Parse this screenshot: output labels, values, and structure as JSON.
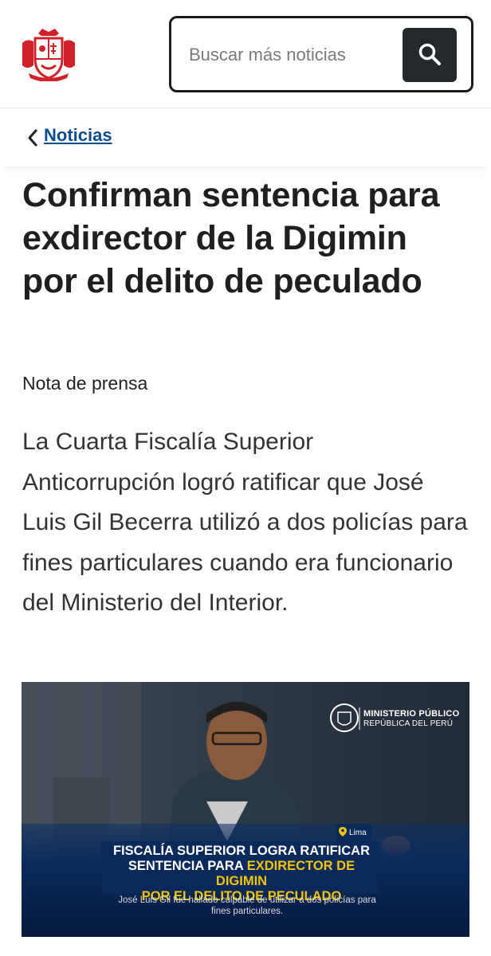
{
  "header": {
    "logo_icon": "peru-coat-of-arms-icon",
    "search": {
      "placeholder": "Buscar más noticias",
      "button_icon": "search-icon"
    }
  },
  "breadcrumb": {
    "back_icon": "chevron-left-icon",
    "label": "Noticias"
  },
  "article": {
    "title": "Confirman sentencia para exdirector de la Digimin por el delito de peculado",
    "type": "Nota de prensa",
    "lead": "La Cuarta Fiscalía Superior Anticorrupción logró ratificar que José Luis Gil Becerra utilizó a dos policías para fines particulares cuando era funcionario del Ministerio del Interior."
  },
  "image": {
    "logo_title": "MINISTERIO PÚBLICO",
    "logo_subtitle": "REPÚBLICA DEL PERÚ",
    "location": "Lima",
    "headline_line1": "FISCALÍA SUPERIOR LOGRA RATIFICAR",
    "headline_line2_white": "SENTENCIA PARA ",
    "headline_line2_yellow": "EXDIRECTOR DE DIGIMIN",
    "headline_line3": "POR EL DELITO DE PECULADO",
    "caption": "José Luis Gil fue hallado culpable de utilizar a dos policías para fines particulares."
  },
  "colors": {
    "link": "#0b4d8c",
    "search_button": "#26292c",
    "logo_red": "#d0212b",
    "headline_yellow": "#f5c400",
    "image_bar": "#0a2a5c"
  }
}
